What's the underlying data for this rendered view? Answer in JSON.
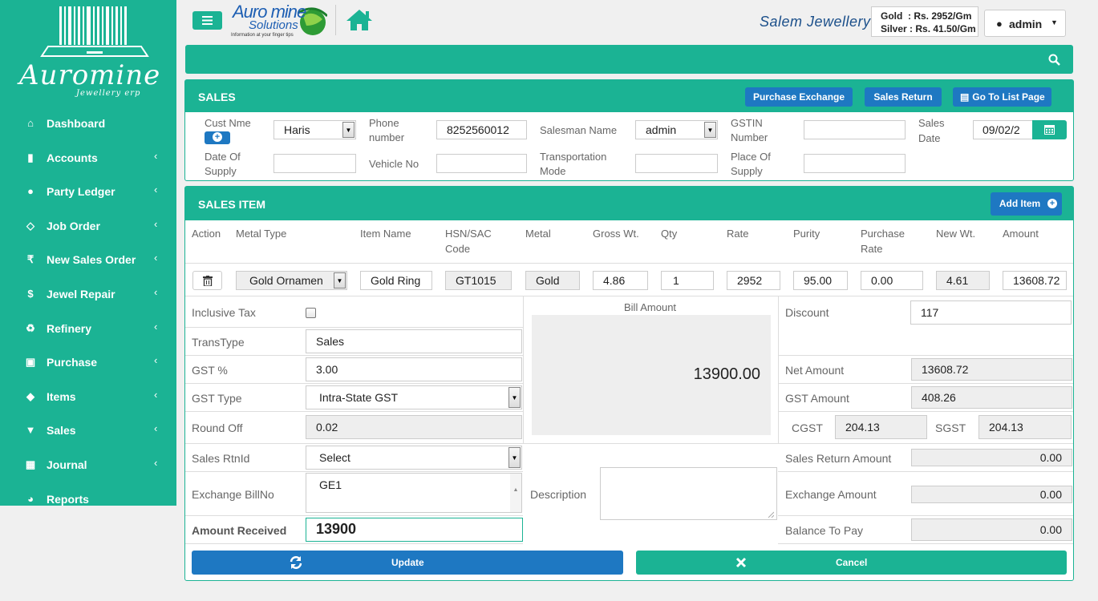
{
  "brand": {
    "logo_text": "Auromine",
    "logo_sub": "Jewellery erp",
    "company_line1": "Auro mine",
    "company_line2": "Solutions",
    "company_tagline": "Information at your finger tips"
  },
  "sidebar": {
    "items": [
      {
        "icon": "home-icon",
        "glyph": "⌂",
        "label": "Dashboard",
        "has_chevron": false
      },
      {
        "icon": "book-icon",
        "glyph": "▮",
        "label": "Accounts",
        "has_chevron": true
      },
      {
        "icon": "user-icon",
        "glyph": "●",
        "label": "Party Ledger",
        "has_chevron": true
      },
      {
        "icon": "diamond-icon",
        "glyph": "◇",
        "label": "Job Order",
        "has_chevron": true
      },
      {
        "icon": "rupee-icon",
        "glyph": "₹",
        "label": "New Sales Order",
        "has_chevron": true
      },
      {
        "icon": "repair-icon",
        "glyph": "$",
        "label": "Jewel Repair",
        "has_chevron": true
      },
      {
        "icon": "recycle-icon",
        "glyph": "♻",
        "label": "Refinery",
        "has_chevron": true
      },
      {
        "icon": "money-icon",
        "glyph": "▣",
        "label": "Purchase",
        "has_chevron": true
      },
      {
        "icon": "tags-icon",
        "glyph": "◆",
        "label": "Items",
        "has_chevron": true
      },
      {
        "icon": "cart-icon",
        "glyph": "▼",
        "label": "Sales",
        "has_chevron": true
      },
      {
        "icon": "table-icon",
        "glyph": "▦",
        "label": "Journal",
        "has_chevron": true
      },
      {
        "icon": "pie-chart-icon",
        "glyph": "◕",
        "label": "Reports",
        "has_chevron": false
      }
    ]
  },
  "header": {
    "store_name": "Salem Jewellery",
    "gold_rate": "Gold  : Rs. 2952/Gm",
    "silver_rate": "Silver : Rs. 41.50/Gm",
    "user": "admin"
  },
  "sales_panel": {
    "title": "SALES",
    "buttons": {
      "purchase_exchange": "Purchase Exchange",
      "sales_return": "Sales Return",
      "go_to_list": "Go To List Page"
    },
    "cust_name_label": "Cust Nme",
    "cust_name": "Haris",
    "phone_label_1": "Phone",
    "phone_label_2": "number",
    "phone": "8252560012",
    "salesman_label": "Salesman Name",
    "salesman": "admin",
    "gstin_label_1": "GSTIN",
    "gstin_label_2": "Number",
    "gstin": "",
    "sales_date_label_1": "Sales",
    "sales_date_label_2": "Date",
    "sales_date": "09/02/2",
    "date_supply_label_1": "Date Of",
    "date_supply_label_2": "Supply",
    "date_supply": "",
    "vehicle_label": "Vehicle No",
    "vehicle": "",
    "transport_label_1": "Transportation",
    "transport_label_2": "Mode",
    "transport": "",
    "place_label_1": "Place Of",
    "place_label_2": "Supply",
    "place": ""
  },
  "item_panel": {
    "title": "SALES ITEM",
    "add_item": "Add Item",
    "columns": [
      "Action",
      "Metal Type",
      "Item Name",
      "HSN/SAC",
      "Code",
      "Metal",
      "Gross Wt.",
      "Qty",
      "Rate",
      "Purity",
      "Purchase",
      "Rate",
      "New Wt.",
      "Amount"
    ],
    "row": {
      "metal_type": "Gold Ornamen",
      "item_name": "Gold Ring",
      "hsn": "GT1015",
      "metal": "Gold",
      "gross_wt": "4.86",
      "qty": "1",
      "rate": "2952",
      "purity": "95.00",
      "purchase_rate": "0.00",
      "new_wt": "4.61",
      "amount": "13608.72"
    }
  },
  "summary": {
    "inclusive_tax_label": "Inclusive Tax",
    "trans_type_label": "TransType",
    "trans_type": "Sales",
    "gst_pct_label": "GST %",
    "gst_pct": "3.00",
    "gst_type_label": "GST Type",
    "gst_type": "Intra-State GST",
    "round_off_label": "Round Off",
    "round_off": "0.02",
    "sales_rtn_label": "Sales RtnId",
    "sales_rtn": "Select",
    "exchange_bill_label": "Exchange BillNo",
    "exchange_bill": "GE1",
    "amount_received_label": "Amount Received",
    "amount_received": "13900",
    "bill_amount_label": "Bill Amount",
    "bill_amount": "13900.00",
    "description_label": "Description",
    "description": "",
    "discount_label": "Discount",
    "discount": "117",
    "net_amount_label": "Net Amount",
    "net_amount": "13608.72",
    "gst_amount_label": "GST Amount",
    "gst_amount": "408.26",
    "cgst_label": "CGST",
    "cgst": "204.13",
    "sgst_label": "SGST",
    "sgst": "204.13",
    "sales_return_amount_label": "Sales Return Amount",
    "sales_return_amount": "0.00",
    "exchange_amount_label": "Exchange Amount",
    "exchange_amount": "0.00",
    "balance_label": "Balance To Pay",
    "balance": "0.00",
    "update": "Update",
    "cancel": "Cancel"
  }
}
